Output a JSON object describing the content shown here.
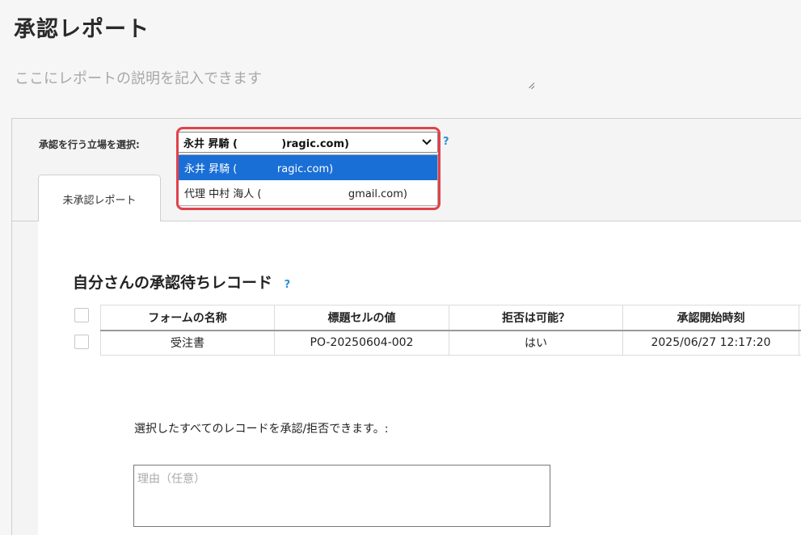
{
  "page": {
    "title": "承認レポート",
    "description_placeholder": "ここにレポートの説明を記入できます"
  },
  "role_selector": {
    "label": "承認を行う立場を選択:",
    "selected_value": "永井 昇騎 (            )ragic.com)",
    "help": "?",
    "options": [
      {
        "label": "永井 昇騎 (            ragic.com)",
        "selected": true
      },
      {
        "label": "代理 中村 海人 (                          gmail.com)",
        "selected": false
      }
    ]
  },
  "tabs": [
    {
      "label": "未承認レポート",
      "active": true
    }
  ],
  "pending_section": {
    "title": "自分さんの承認待ちレコード",
    "help": "?",
    "columns": [
      "フォームの名称",
      "標題セルの値",
      "拒否は可能？",
      "承認開始時刻"
    ],
    "rows": [
      [
        "受注書",
        "PO-20250604-002",
        "はい",
        "2025/06/27 12:17:20"
      ]
    ]
  },
  "bulk_action": {
    "text": "選択したすべてのレコードを承認/拒否できます。:",
    "reason_placeholder": "理由（任意）"
  },
  "colors": {
    "highlight_outline": "#e0424a",
    "selected_option": "#1a6fd6",
    "help_icon": "#2c8fd6"
  }
}
